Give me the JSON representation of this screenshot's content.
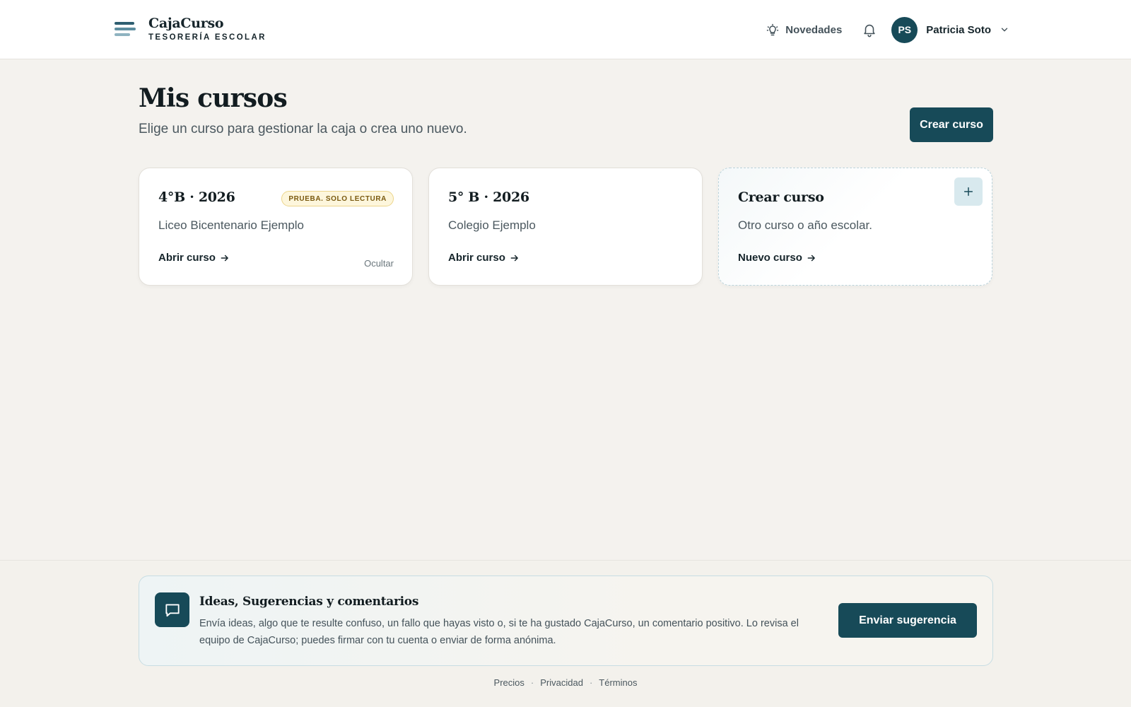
{
  "header": {
    "brand_name": "CajaCurso",
    "brand_sub": "TESORERÍA ESCOLAR",
    "novedades": "Novedades",
    "user_initials": "PS",
    "user_name": "Patricia Soto"
  },
  "main": {
    "title": "Mis cursos",
    "subtitle": "Elige un curso para gestionar la caja o crea uno nuevo.",
    "create_button": "Crear curso",
    "cards": [
      {
        "title": "4°B · 2026",
        "badge": "PRUEBA. SOLO LECTURA",
        "school": "Liceo Bicentenario Ejemplo",
        "link": "Abrir curso",
        "hide": "Ocultar"
      },
      {
        "title": "5° B · 2026",
        "school": "Colegio Ejemplo",
        "link": "Abrir curso"
      },
      {
        "title": "Crear curso",
        "school": "Otro curso o año escolar.",
        "link": "Nuevo curso",
        "plus": "+"
      }
    ]
  },
  "feedback": {
    "title": "Ideas, Sugerencias y comentarios",
    "text": "Envía ideas, algo que te resulte confuso, un fallo que hayas visto o, si te ha gustado CajaCurso, un comentario positivo. Lo revisa el equipo de CajaCurso; puedes firmar con tu cuenta o enviar de forma anónima.",
    "button": "Enviar sugerencia"
  },
  "footer": {
    "links": [
      "Precios",
      "Privacidad",
      "Términos"
    ],
    "separator": "·"
  },
  "icons": {
    "brand": "menu-lines-icon",
    "novedades": "lightbulb-icon",
    "notifications": "bell-icon",
    "user_menu": "chevron-down-icon",
    "card_link": "arrow-right-icon",
    "feedback": "chat-bubble-icon"
  },
  "colors": {
    "primary": "#174a58",
    "badge_bg": "#fdf6dc",
    "badge_border": "#ecd58a",
    "plus_bg": "#d8e9ee"
  }
}
